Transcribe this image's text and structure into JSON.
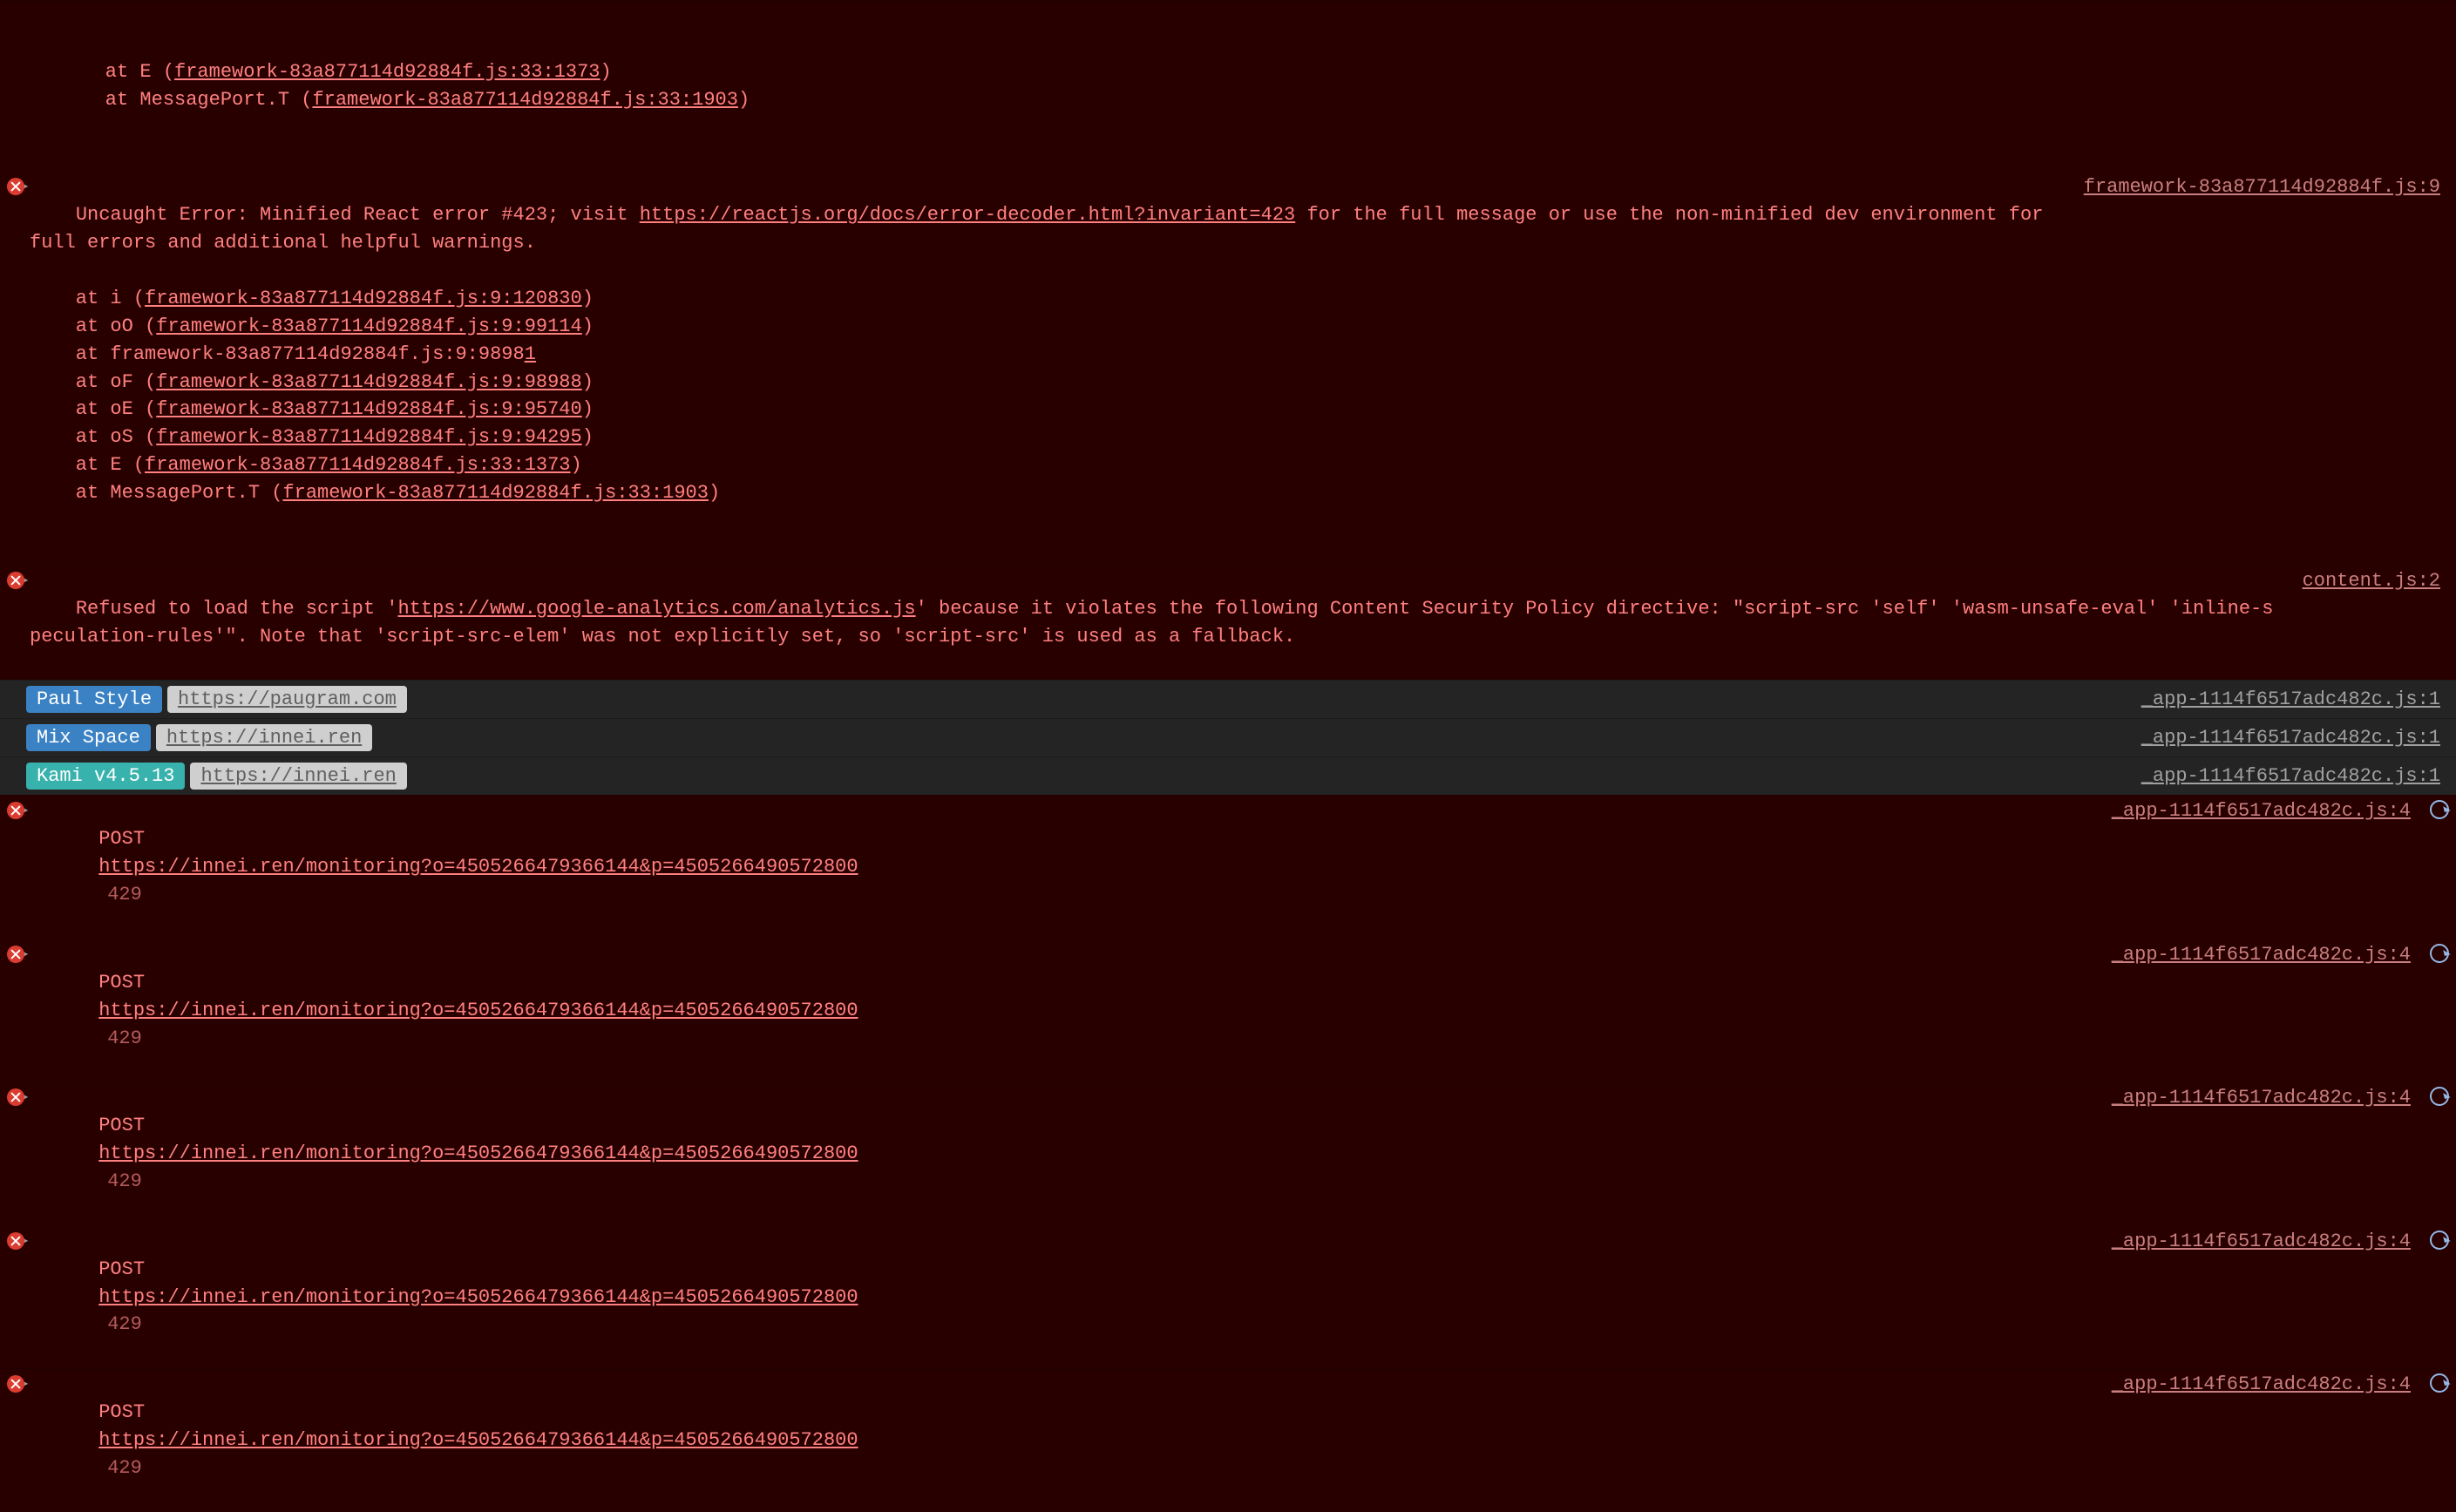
{
  "topStack": [
    "    at E (framework-83a877114d92884f.js:33:1373)",
    "    at MessagePort.T (framework-83a877114d92884f.js:33:1903)"
  ],
  "reactError": {
    "prefix": "Uncaught Error: Minified React error #423; visit ",
    "link": "https://reactjs.org/docs/error-decoder.html?invariant=423",
    "suffix": " for the full message or use the non-minified dev environment for full errors and additional helpful warnings.",
    "source": "framework-83a877114d92884f.js:9",
    "stack": [
      "    at i (framework-83a877114d92884f.js:9:120830)",
      "    at oO (framework-83a877114d92884f.js:9:99114)",
      "    at framework-83a877114d92884f.js:9:98981",
      "    at oF (framework-83a877114d92884f.js:9:98988)",
      "    at oE (framework-83a877114d92884f.js:9:95740)",
      "    at oS (framework-83a877114d92884f.js:9:94295)",
      "    at E (framework-83a877114d92884f.js:33:1373)",
      "    at MessagePort.T (framework-83a877114d92884f.js:33:1903)"
    ]
  },
  "cspError": {
    "prefix": "Refused to load the script '",
    "link": "https://www.google-analytics.com/analytics.js",
    "suffix": "' because it violates the following Content Security Policy directive: \"script-src 'self' 'wasm-unsafe-eval' 'inline-speculation-rules'\". Note that 'script-src-elem' was not explicitly set, so 'script-src' is used as a fallback.",
    "source": "content.js:2"
  },
  "logs": [
    {
      "badge": "Paul Style",
      "badgeClass": "blue",
      "url": "https://paugram.com",
      "source": "_app-1114f6517adc482c.js:1"
    },
    {
      "badge": "Mix Space",
      "badgeClass": "blue",
      "url": "https://innei.ren",
      "source": "_app-1114f6517adc482c.js:1"
    },
    {
      "badge": "Kami v4.5.13",
      "badgeClass": "teal",
      "url": "https://innei.ren",
      "source": "_app-1114f6517adc482c.js:1"
    }
  ],
  "netErrors": {
    "method": "POST",
    "url": "https://innei.ren/monitoring?o=4505266479366144&p=4505266490572800",
    "status": "429",
    "source": "_app-1114f6517adc482c.js:4",
    "count": 5
  }
}
